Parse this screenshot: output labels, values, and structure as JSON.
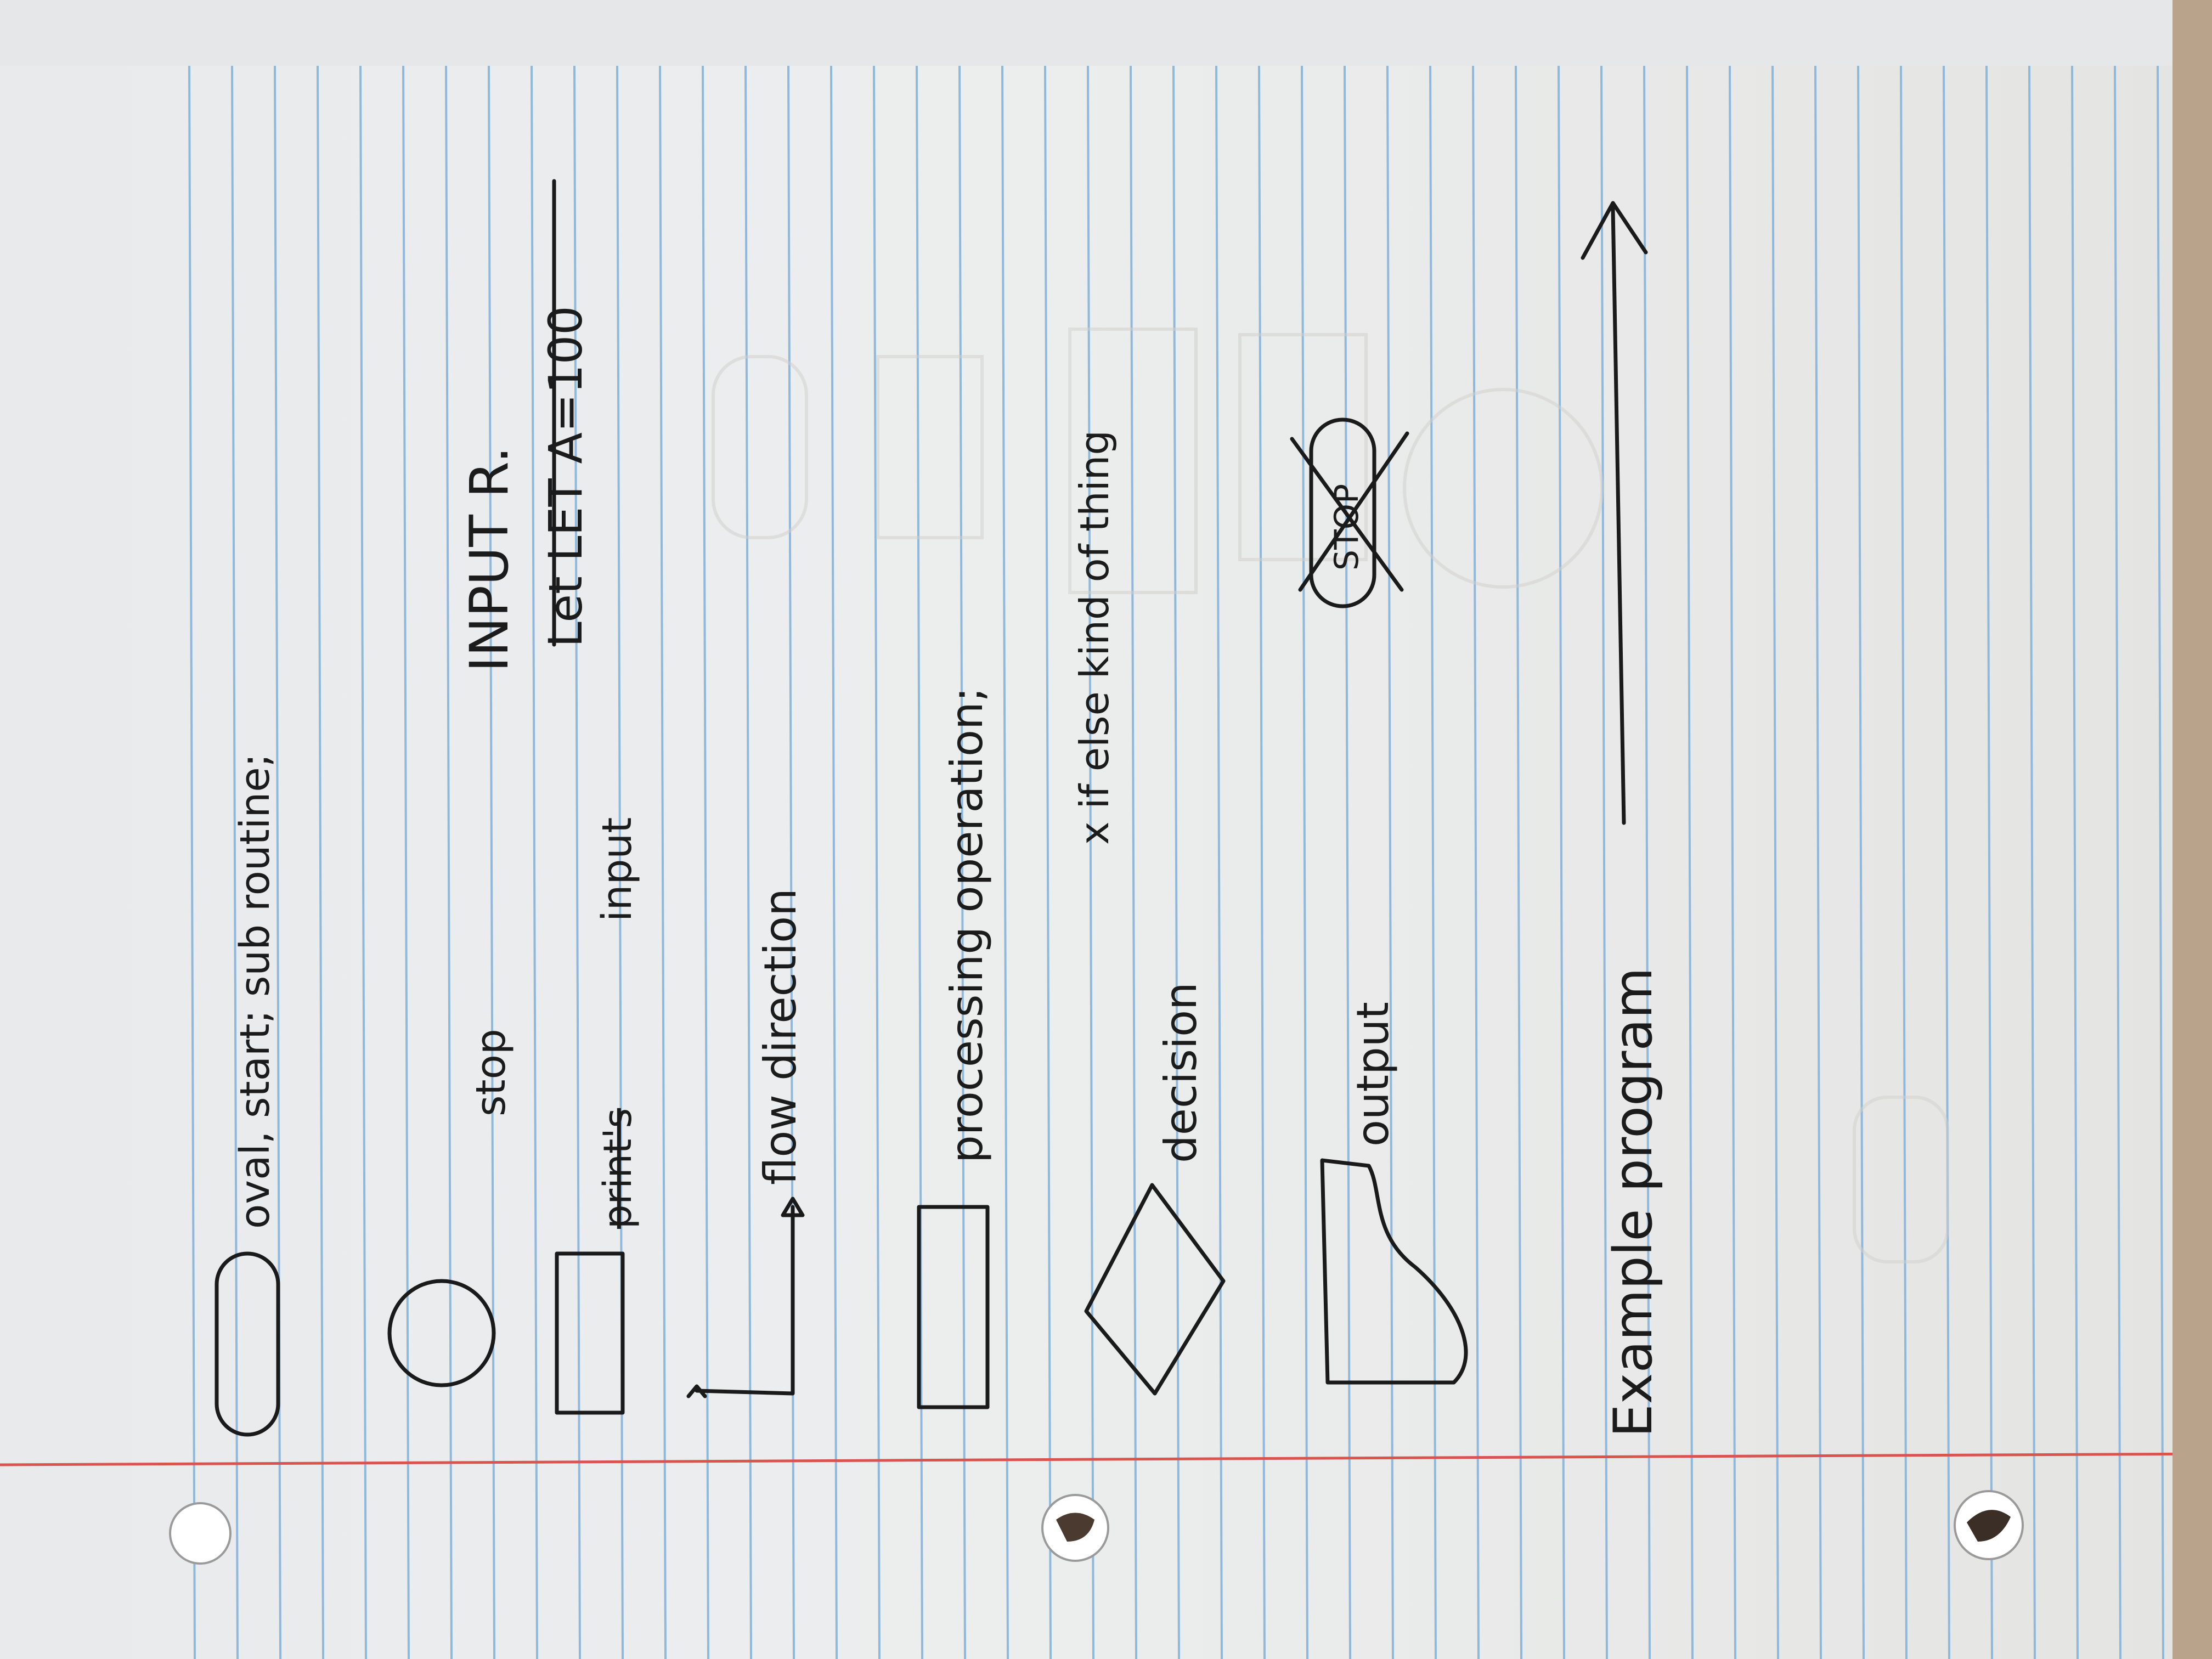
{
  "notes": {
    "labels": {
      "oval": "oval, start; sub routine;",
      "stop": "stop",
      "print_struck": "print's",
      "input": "input",
      "input_example": "INPUT R.",
      "let_example": "Let LET A=100",
      "flow": "flow direction",
      "processing": "processing operation;",
      "if_else": "x if else kind of thing",
      "decision": "decision",
      "output": "output",
      "stop_crossed": "STOP",
      "example": "Example program"
    }
  },
  "colors": {
    "paper": "#eceeee",
    "rule_line": "#8fb8dc",
    "margin_line": "#d9534f",
    "ink": "#1a1a1a"
  }
}
